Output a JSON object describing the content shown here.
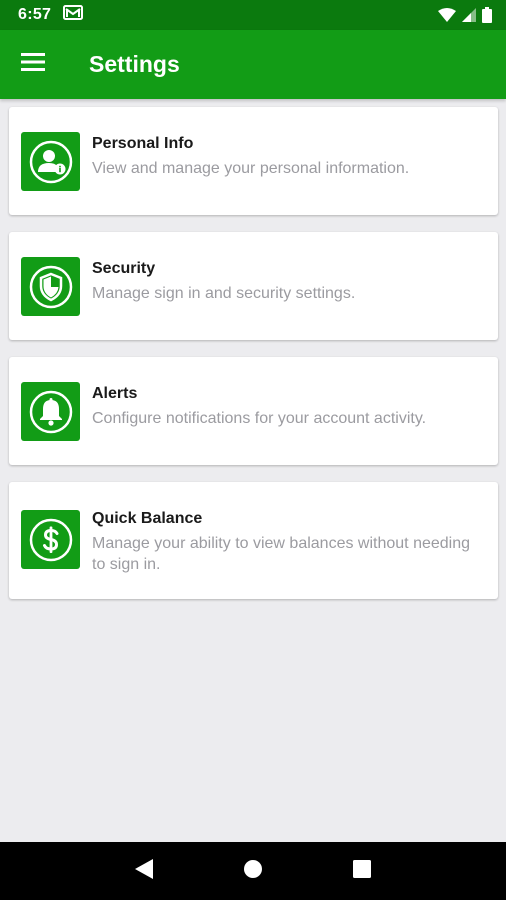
{
  "status_bar": {
    "time": "6:57",
    "icons": [
      "gmail-icon",
      "wifi-icon",
      "signal-icon",
      "battery-icon"
    ]
  },
  "app_bar": {
    "title": "Settings",
    "menu_icon": "hamburger-menu-icon"
  },
  "colors": {
    "status_bar": "#0b7a0e",
    "app_bar": "#129c16",
    "icon_tile": "#129c16",
    "background": "#ececef",
    "title_text": "#1a1a1a",
    "desc_text": "#9b9ba0"
  },
  "settings_items": [
    {
      "title": "Personal Info",
      "description": "View and manage your personal information.",
      "icon": "personal-info-icon"
    },
    {
      "title": "Security",
      "description": "Manage sign in and security settings.",
      "icon": "shield-icon"
    },
    {
      "title": "Alerts",
      "description": "Configure notifications for your account activity.",
      "icon": "bell-icon"
    },
    {
      "title": "Quick Balance",
      "description": "Manage your ability to view balances without needing to sign in.",
      "icon": "dollar-icon"
    }
  ],
  "nav_bar": {
    "buttons": [
      "back-icon",
      "home-icon",
      "recents-icon"
    ]
  }
}
